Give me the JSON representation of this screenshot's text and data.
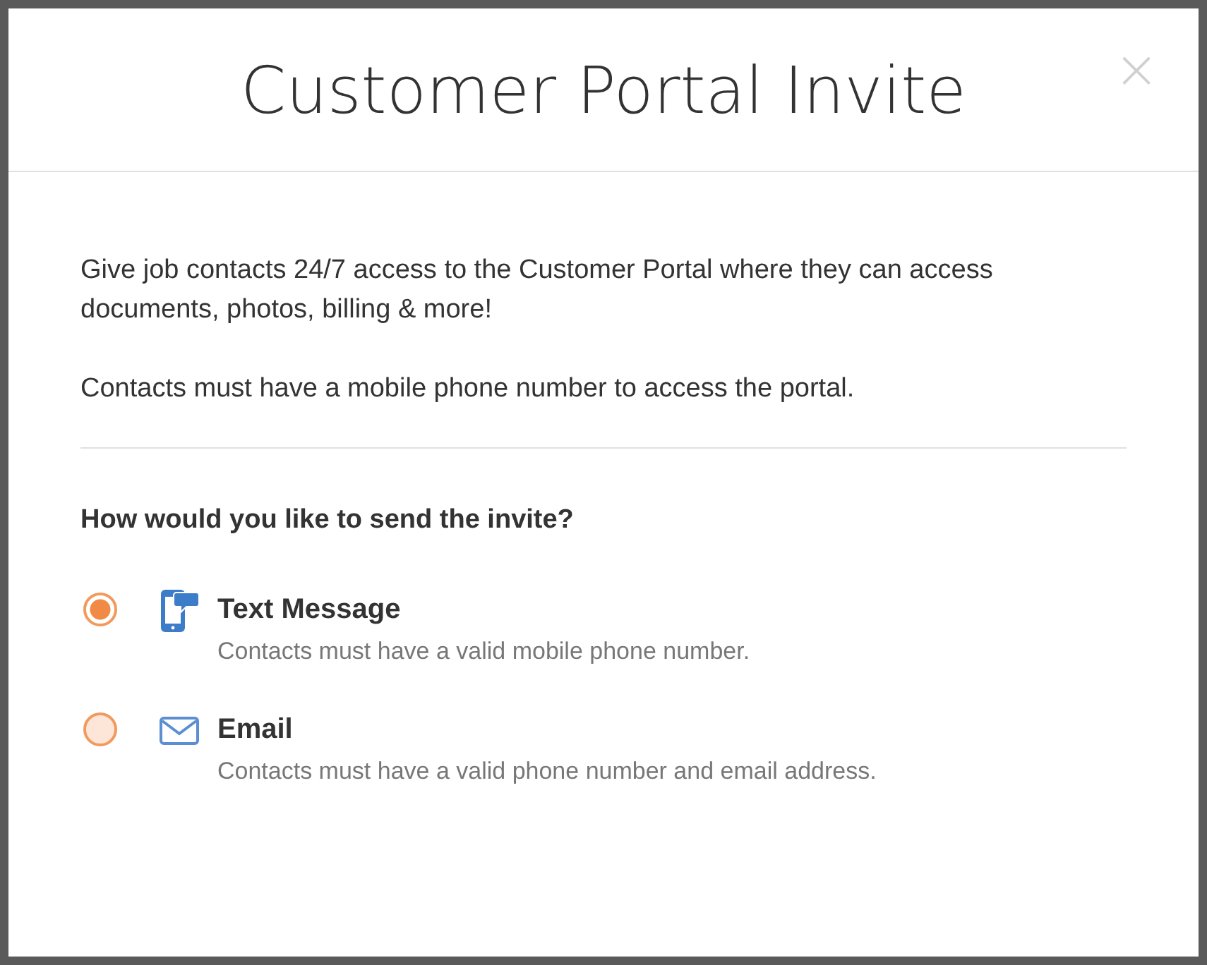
{
  "dialog": {
    "title": "Customer Portal Invite",
    "close": "×"
  },
  "intro": [
    "Give job contacts 24/7 access to the Customer Portal where they can access documents, photos, billing & more!",
    "Contacts must have a mobile phone number to access the portal."
  ],
  "question": "How would you like to send the invite?",
  "options": [
    {
      "kind": "sms",
      "label": "Text Message",
      "description": "Contacts must have a valid mobile phone number.",
      "selected": true
    },
    {
      "kind": "email",
      "label": "Email",
      "description": "Contacts must have a valid phone number and email address.",
      "selected": false
    }
  ]
}
